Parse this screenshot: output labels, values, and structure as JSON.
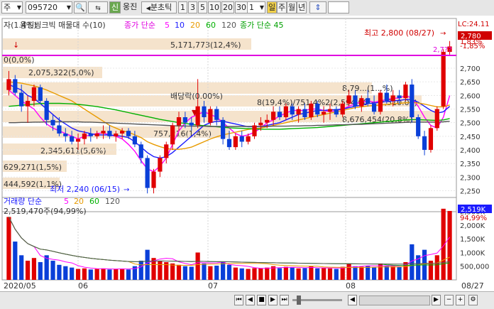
{
  "toolbar": {
    "market": "주",
    "code": "095720",
    "credit_badge": "신",
    "stock_name": "웅진",
    "tick_label": "분초틱",
    "periods": [
      "1",
      "3",
      "5",
      "10",
      "20",
      "30"
    ],
    "count": "1",
    "day": "일",
    "week": "주",
    "month": "월",
    "year": "년"
  },
  "price_panel": {
    "legend_left": "자(1.4%)",
    "legend_main": "웅진씽크빅 매물대 수(10)",
    "ma_label": "종가 단순",
    "ma_periods": [
      "5",
      "10",
      "20",
      "60",
      "120"
    ],
    "ma_colors": [
      "#ff00ff",
      "#1a1aff",
      "#e89b00",
      "#00b000",
      "#555555"
    ],
    "ma45_label": "종가 단순 45",
    "lc_label": "LC:24.11",
    "high_label": "최고 2,800 (08/27)",
    "low_label": "최저 2,240 (06/15)",
    "dividend_label": "배당락(0.00%)",
    "hline_label": "2,7??",
    "current_price": "2,780",
    "y_ticks": [
      "1,83%",
      "-1,85%",
      "2,700",
      "2,650",
      "2,600",
      "2,550",
      "2,500",
      "2,450",
      "2,400",
      "2,350",
      "2,300",
      "2,250"
    ],
    "volume_profile": [
      {
        "label": "5,171,773(12,4%)"
      },
      {
        "label": "0(0,0%)"
      },
      {
        "label": "2,075,322(5,0%)"
      },
      {
        "label": "8,79...(1...%)"
      },
      {
        "label": "8(19,4%)/751,4%2(2,594.00 ~ 2,510.00)"
      },
      {
        "label": "8,676,454(20,8%)"
      },
      {
        "label": "757,216(1,4%)"
      },
      {
        "label": "2,345,611(5,6%)"
      },
      {
        "label": "629,271(1,5%)"
      },
      {
        "label": "444,592(1,1%)"
      }
    ]
  },
  "volume_panel": {
    "title": "거래량 단순",
    "ma_periods": [
      "5",
      "20",
      "60",
      "120"
    ],
    "ma_colors": [
      "#ff00ff",
      "#e89b00",
      "#00b000",
      "#555555"
    ],
    "value_label": "2,519,470주(94,99%)",
    "current_volume": "2,519K",
    "current_pct": "94,99%",
    "y_ticks": [
      "2,500K",
      "2,000K",
      "1,500K",
      "1,000K",
      "500,000"
    ]
  },
  "x_axis": {
    "labels": [
      "2020/05",
      "06",
      "07",
      "08"
    ],
    "last_date": "08/27"
  },
  "chart_data": {
    "type": "candlestick",
    "title": "웅진씽크빅",
    "y_range": [
      2225,
      2815
    ],
    "candles": [
      [
        2620,
        2690,
        2600,
        2660
      ],
      [
        2660,
        2675,
        2600,
        2610
      ],
      [
        2610,
        2640,
        2540,
        2560
      ],
      [
        2560,
        2600,
        2500,
        2580
      ],
      [
        2580,
        2640,
        2560,
        2630
      ],
      [
        2630,
        2640,
        2570,
        2580
      ],
      [
        2580,
        2590,
        2490,
        2510
      ],
      [
        2510,
        2530,
        2470,
        2490
      ],
      [
        2490,
        2520,
        2450,
        2460
      ],
      [
        2460,
        2480,
        2430,
        2450
      ],
      [
        2450,
        2470,
        2420,
        2430
      ],
      [
        2430,
        2460,
        2400,
        2440
      ],
      [
        2440,
        2470,
        2420,
        2460
      ],
      [
        2460,
        2480,
        2430,
        2450
      ],
      [
        2450,
        2470,
        2440,
        2460
      ],
      [
        2460,
        2490,
        2440,
        2470
      ],
      [
        2470,
        2490,
        2440,
        2450
      ],
      [
        2450,
        2470,
        2430,
        2460
      ],
      [
        2460,
        2480,
        2440,
        2470
      ],
      [
        2470,
        2480,
        2440,
        2450
      ],
      [
        2450,
        2470,
        2410,
        2420
      ],
      [
        2420,
        2430,
        2350,
        2370
      ],
      [
        2370,
        2380,
        2240,
        2260
      ],
      [
        2260,
        2330,
        2240,
        2320
      ],
      [
        2320,
        2380,
        2300,
        2370
      ],
      [
        2370,
        2430,
        2350,
        2420
      ],
      [
        2420,
        2500,
        2400,
        2490
      ],
      [
        2490,
        2540,
        2470,
        2520
      ],
      [
        2520,
        2540,
        2480,
        2500
      ],
      [
        2500,
        2520,
        2470,
        2490
      ],
      [
        2490,
        2660,
        2480,
        2560
      ],
      [
        2560,
        2580,
        2500,
        2520
      ],
      [
        2500,
        2560,
        2490,
        2550
      ],
      [
        2550,
        2560,
        2490,
        2510
      ],
      [
        2510,
        2520,
        2420,
        2440
      ],
      [
        2440,
        2470,
        2400,
        2410
      ],
      [
        2410,
        2460,
        2400,
        2450
      ],
      [
        2450,
        2470,
        2410,
        2430
      ],
      [
        2430,
        2460,
        2420,
        2450
      ],
      [
        2450,
        2500,
        2440,
        2490
      ],
      [
        2490,
        2520,
        2470,
        2500
      ],
      [
        2500,
        2530,
        2480,
        2510
      ],
      [
        2510,
        2560,
        2490,
        2540
      ],
      [
        2540,
        2560,
        2510,
        2520
      ],
      [
        2520,
        2570,
        2510,
        2560
      ],
      [
        2560,
        2570,
        2510,
        2530
      ],
      [
        2530,
        2560,
        2500,
        2550
      ],
      [
        2550,
        2570,
        2510,
        2520
      ],
      [
        2520,
        2580,
        2510,
        2570
      ],
      [
        2570,
        2580,
        2520,
        2530
      ],
      [
        2530,
        2560,
        2500,
        2540
      ],
      [
        2540,
        2570,
        2510,
        2550
      ],
      [
        2550,
        2560,
        2520,
        2530
      ],
      [
        2530,
        2580,
        2520,
        2570
      ],
      [
        2570,
        2620,
        2560,
        2600
      ],
      [
        2600,
        2620,
        2550,
        2560
      ],
      [
        2560,
        2600,
        2540,
        2590
      ],
      [
        2590,
        2620,
        2560,
        2570
      ],
      [
        2570,
        2600,
        2530,
        2540
      ],
      [
        2540,
        2620,
        2530,
        2610
      ],
      [
        2610,
        2640,
        2570,
        2580
      ],
      [
        2580,
        2620,
        2560,
        2600
      ],
      [
        2600,
        2620,
        2570,
        2590
      ],
      [
        2590,
        2650,
        2580,
        2640
      ],
      [
        2640,
        2660,
        2500,
        2520
      ],
      [
        2520,
        2530,
        2440,
        2450
      ],
      [
        2450,
        2470,
        2380,
        2400
      ],
      [
        2400,
        2490,
        2390,
        2480
      ],
      [
        2480,
        2560,
        2470,
        2550
      ],
      [
        2560,
        2770,
        2550,
        2760
      ],
      [
        2760,
        2800,
        2750,
        2780
      ]
    ],
    "volumes": [
      2300,
      1400,
      900,
      700,
      800,
      650,
      900,
      700,
      550,
      500,
      450,
      400,
      420,
      380,
      400,
      420,
      380,
      400,
      410,
      380,
      500,
      700,
      1100,
      800,
      700,
      650,
      600,
      550,
      500,
      480,
      1000,
      600,
      500,
      520,
      650,
      550,
      450,
      420,
      400,
      430,
      420,
      450,
      500,
      430,
      480,
      450,
      420,
      430,
      500,
      420,
      430,
      420,
      400,
      480,
      600,
      500,
      480,
      520,
      460,
      600,
      520,
      500,
      480,
      650,
      1300,
      900,
      1100,
      700,
      900,
      2600,
      2519
    ],
    "ma_series": [
      {
        "name": "5",
        "color": "#ff00ff",
        "values": [
          2620,
          2600,
          2580,
          2565,
          2550,
          2520,
          2495,
          2480,
          2470,
          2460,
          2450,
          2440,
          2450,
          2455,
          2460,
          2462,
          2455,
          2450,
          2440,
          2420,
          2395,
          2360,
          2330,
          2320,
          2340,
          2370,
          2420,
          2470,
          2500,
          2520,
          2530,
          2540,
          2530,
          2520,
          2500,
          2480,
          2460,
          2450,
          2455,
          2465,
          2480,
          2500,
          2510,
          2525,
          2535,
          2545,
          2545,
          2545,
          2550,
          2550,
          2545,
          2540,
          2545,
          2550,
          2560,
          2570,
          2575,
          2580,
          2575,
          2580,
          2585,
          2590,
          2590,
          2600,
          2590,
          2560,
          2520,
          2490,
          2480,
          2520,
          2600
        ]
      },
      {
        "name": "10",
        "color": "#1a1aff",
        "values": [
          2640,
          2630,
          2620,
          2600,
          2590,
          2570,
          2550,
          2530,
          2510,
          2495,
          2480,
          2470,
          2465,
          2460,
          2455,
          2455,
          2455,
          2452,
          2450,
          2445,
          2430,
          2410,
          2390,
          2375,
          2370,
          2375,
          2390,
          2410,
          2430,
          2450,
          2470,
          2490,
          2500,
          2505,
          2505,
          2500,
          2495,
          2490,
          2485,
          2485,
          2485,
          2490,
          2495,
          2500,
          2510,
          2520,
          2530,
          2535,
          2540,
          2545,
          2545,
          2547,
          2548,
          2550,
          2555,
          2560,
          2565,
          2570,
          2572,
          2575,
          2578,
          2580,
          2582,
          2585,
          2585,
          2575,
          2560,
          2545,
          2535,
          2540,
          2560
        ]
      },
      {
        "name": "20",
        "color": "#e89b00",
        "values": [
          2650,
          2648,
          2645,
          2640,
          2635,
          2628,
          2620,
          2610,
          2600,
          2590,
          2580,
          2565,
          2550,
          2535,
          2520,
          2505,
          2490,
          2480,
          2470,
          2465,
          2455,
          2445,
          2430,
          2420,
          2412,
          2405,
          2402,
          2402,
          2405,
          2410,
          2420,
          2430,
          2440,
          2448,
          2455,
          2460,
          2465,
          2470,
          2475,
          2478,
          2480,
          2485,
          2490,
          2495,
          2500,
          2505,
          2510,
          2515,
          2520,
          2525,
          2530,
          2535,
          2540,
          2545,
          2550,
          2555,
          2558,
          2561,
          2563,
          2565,
          2567,
          2569,
          2571,
          2573,
          2574,
          2572,
          2568,
          2563,
          2558,
          2558,
          2565
        ]
      },
      {
        "name": "60",
        "color": "#00b000",
        "values": [
          2560,
          2562,
          2564,
          2566,
          2568,
          2570,
          2571,
          2571,
          2571,
          2570,
          2569,
          2567,
          2565,
          2562,
          2559,
          2555,
          2551,
          2547,
          2542,
          2537,
          2532,
          2527,
          2522,
          2517,
          2512,
          2508,
          2504,
          2500,
          2497,
          2494,
          2491,
          2489,
          2487,
          2485,
          2483,
          2481,
          2480,
          2479,
          2478,
          2477,
          2476,
          2476,
          2476,
          2476,
          2477,
          2478,
          2479,
          2480,
          2481,
          2482,
          2484,
          2486,
          2488,
          2490,
          2492,
          2494,
          2496,
          2498,
          2500,
          2502,
          2504,
          2506,
          2508,
          2510,
          2511,
          2511,
          2510,
          2509,
          2508,
          2510,
          2515
        ]
      },
      {
        "name": "120",
        "color": "#555555",
        "values": [
          2500,
          2500,
          2501,
          2501,
          2502,
          2502,
          2503,
          2503,
          2503,
          2503,
          2503,
          2503,
          2502,
          2502,
          2501,
          2500,
          2499,
          2498,
          2497,
          2496,
          2495,
          2494,
          2493,
          2492,
          2491,
          2490,
          2489,
          2488,
          2488,
          2487,
          2487,
          2487,
          2486,
          2486,
          2486,
          2486,
          2486,
          2486,
          2486,
          2486,
          2486,
          2486,
          2487,
          2487,
          2487,
          2488,
          2488,
          2489,
          2489,
          2490,
          2490,
          2491,
          2492,
          2492,
          2493,
          2494,
          2494,
          2495,
          2496,
          2497,
          2498,
          2499,
          2500,
          2501,
          2502,
          2502,
          2502,
          2502,
          2502,
          2503,
          2505
        ]
      }
    ]
  }
}
